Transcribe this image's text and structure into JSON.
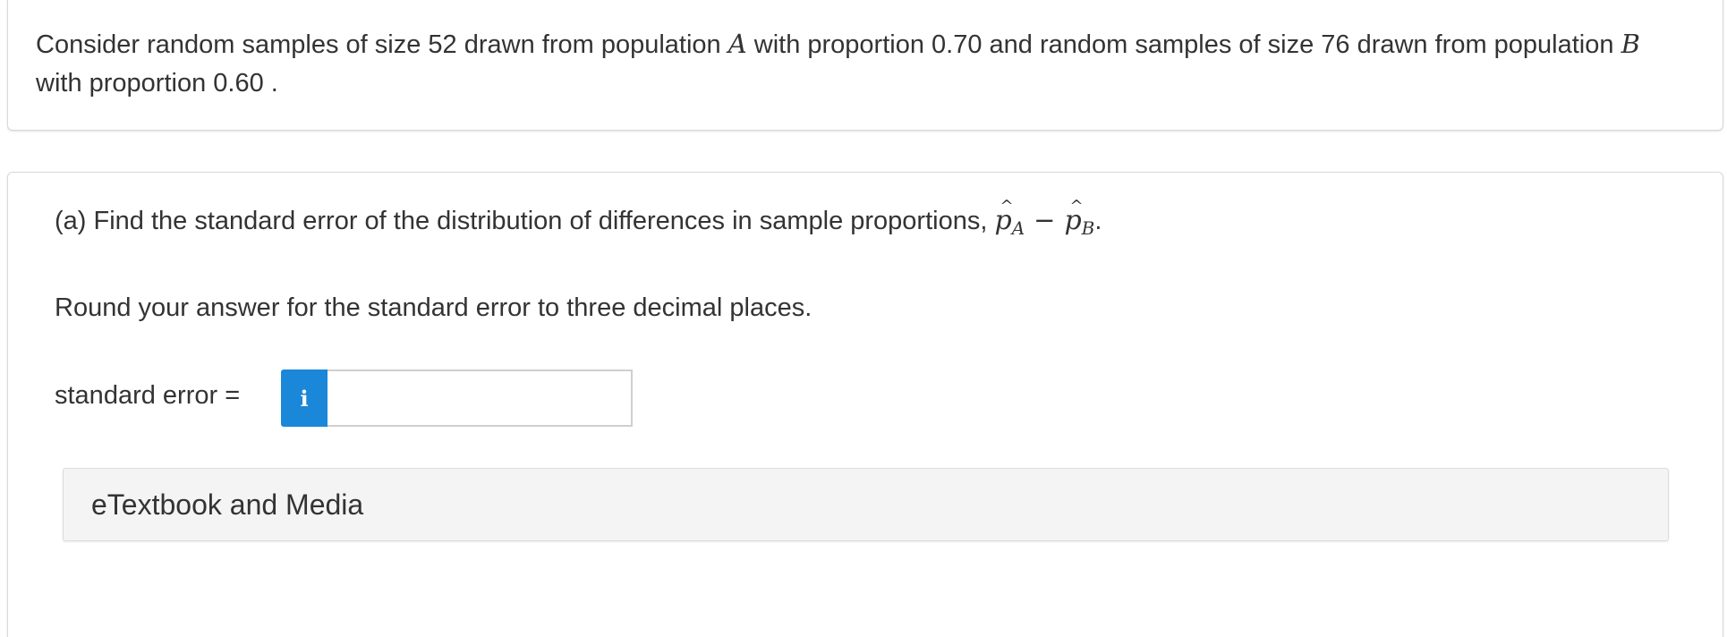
{
  "intro": {
    "part1": "Consider random samples of size 52 drawn from population ",
    "var_a": "A",
    "part2": " with proportion 0.70 and random samples of size 76 drawn from population ",
    "var_b": "B",
    "part3": " with proportion 0.60 ."
  },
  "part_a": {
    "prompt": "(a) Find the standard error of the distribution of differences in sample proportions, ",
    "p_symbol": "p",
    "hat_symbol": "^",
    "sub_a": "A",
    "minus": "−",
    "sub_b": "B",
    "period": "."
  },
  "round_instruction": "Round your answer for the standard error to three decimal places.",
  "answer": {
    "label": "standard error =",
    "info_icon_glyph": "i",
    "value": "",
    "placeholder": ""
  },
  "etextbook": {
    "label": "eTextbook and Media"
  },
  "colors": {
    "info_button": "#1a87d9",
    "text": "#333333",
    "panel_bg": "#f4f4f4"
  }
}
